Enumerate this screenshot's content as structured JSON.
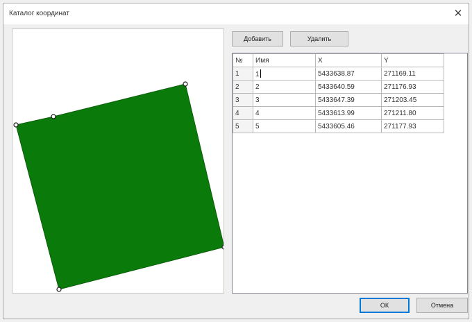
{
  "dialog": {
    "title": "Каталог координат"
  },
  "toolbar": {
    "add_label": "Добавить",
    "delete_label": "Удалить"
  },
  "footer": {
    "ok_label": "ОК",
    "cancel_label": "Отмена"
  },
  "table": {
    "columns": [
      "№",
      "Имя",
      "X",
      "Y"
    ],
    "rows": [
      {
        "num": "1",
        "name": "1",
        "x": "5433638.87",
        "y": "271169.11"
      },
      {
        "num": "2",
        "name": "2",
        "x": "5433640.59",
        "y": "271176.93"
      },
      {
        "num": "3",
        "name": "3",
        "x": "5433647.39",
        "y": "271203.45"
      },
      {
        "num": "4",
        "name": "4",
        "x": "5433613.99",
        "y": "271211.80"
      },
      {
        "num": "5",
        "name": "5",
        "x": "5433605.46",
        "y": "271177.93"
      }
    ]
  },
  "preview": {
    "fill_color": "#0a7a0a",
    "vertex_color": "#1a1a1a"
  },
  "icons": {
    "close": "close-icon"
  }
}
